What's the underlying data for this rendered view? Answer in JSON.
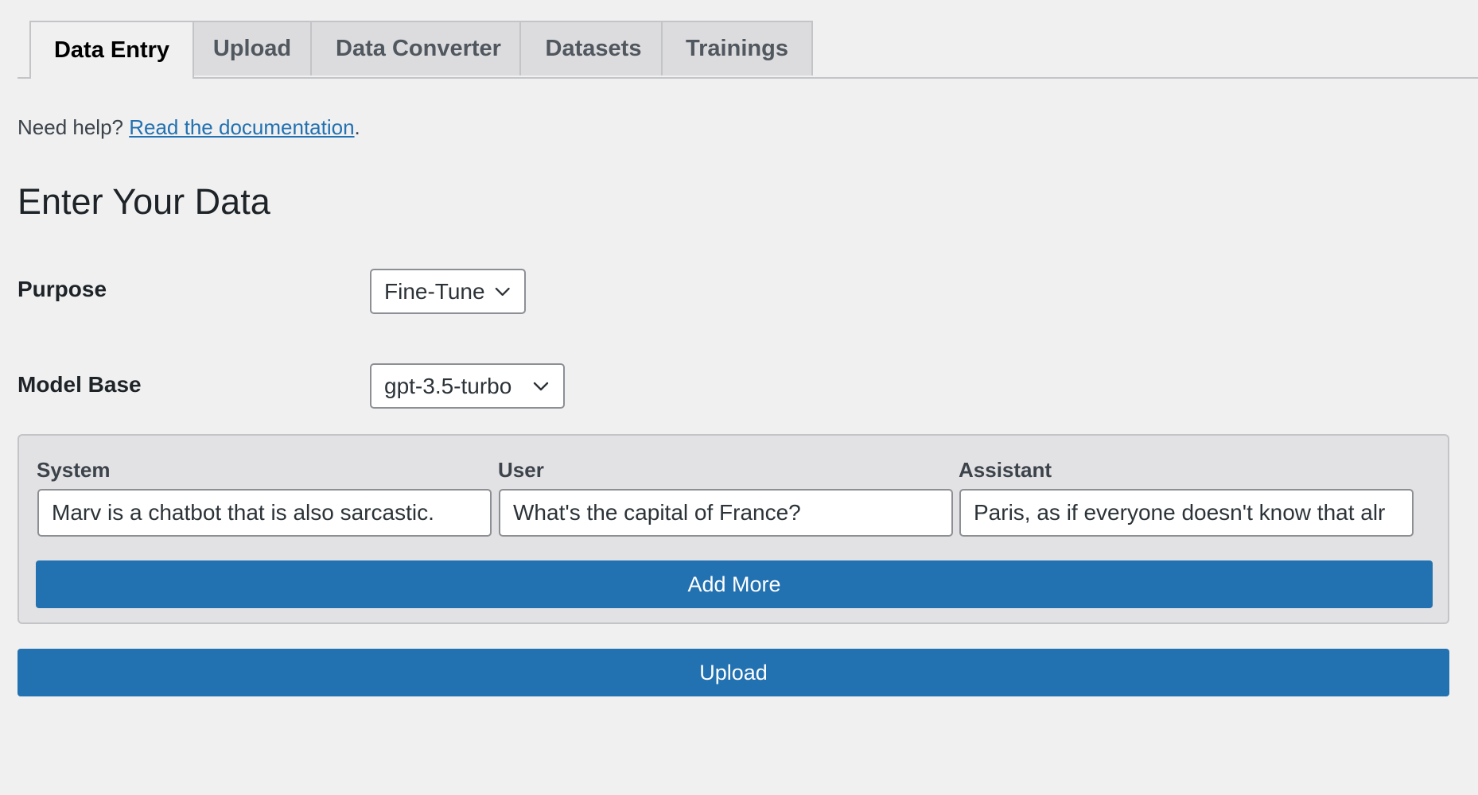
{
  "tabs": [
    {
      "label": "Data Entry",
      "active": true
    },
    {
      "label": "Upload",
      "active": false
    },
    {
      "label": "Data Converter",
      "active": false
    },
    {
      "label": "Datasets",
      "active": false
    },
    {
      "label": "Trainings",
      "active": false
    }
  ],
  "help": {
    "prefix": "Need help? ",
    "link_text": "Read the documentation",
    "suffix": "."
  },
  "heading": "Enter Your Data",
  "form": {
    "purpose": {
      "label": "Purpose",
      "selected": "Fine-Tune"
    },
    "model_base": {
      "label": "Model Base",
      "selected": "gpt-3.5-turbo"
    }
  },
  "conversation": {
    "columns": {
      "system": "System",
      "user": "User",
      "assistant": "Assistant"
    },
    "row": {
      "system": "Marv is a chatbot that is also sarcastic.",
      "user": "What's the capital of France?",
      "assistant": "Paris, as if everyone doesn't know that alr"
    },
    "add_more_label": "Add More"
  },
  "upload_label": "Upload",
  "colors": {
    "accent": "#2271b1",
    "background": "#f0f0f1",
    "panel": "#e2e2e4"
  },
  "icons": {
    "select_chevron": "chevron-down-icon"
  }
}
